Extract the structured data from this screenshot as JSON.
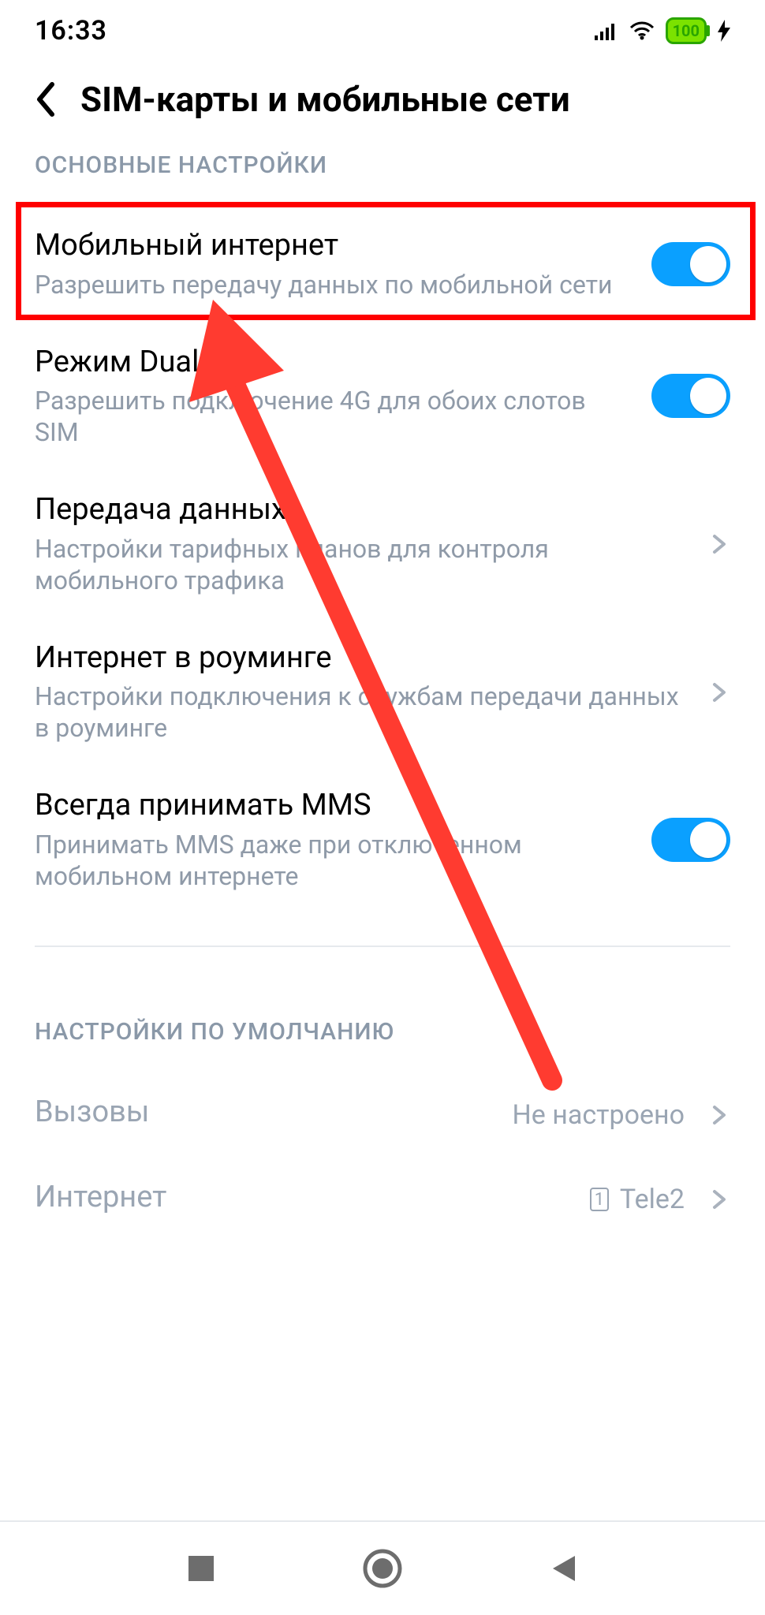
{
  "status": {
    "time": "16:33",
    "battery_text": "100"
  },
  "header": {
    "title": "SIM-карты и мобильные сети"
  },
  "sections": {
    "main_label": "ОСНОВНЫЕ НАСТРОЙКИ",
    "default_label": "НАСТРОЙКИ ПО УМОЛЧАНИЮ"
  },
  "rows": {
    "mobile_data": {
      "title": "Мобильный интернет",
      "sub": "Разрешить передачу данных по мобильной сети",
      "on": true
    },
    "dual4g": {
      "title": "Режим Dual 4G",
      "sub": "Разрешить подключение 4G для обоих слотов SIM",
      "on": true
    },
    "data_usage": {
      "title": "Передача данных",
      "sub": "Настройки тарифных планов для контроля мобильного трафика"
    },
    "roaming": {
      "title": "Интернет в роуминге",
      "sub": "Настройки подключения к службам передачи данных в роуминге"
    },
    "mms": {
      "title": "Всегда принимать MMS",
      "sub": "Принимать MMS даже при отключенном мобильном интернете",
      "on": true
    },
    "calls": {
      "title": "Вызовы",
      "value": "Не настроено"
    },
    "internet": {
      "title": "Интернет",
      "sim_slot": "1",
      "value": "Tele2"
    }
  }
}
